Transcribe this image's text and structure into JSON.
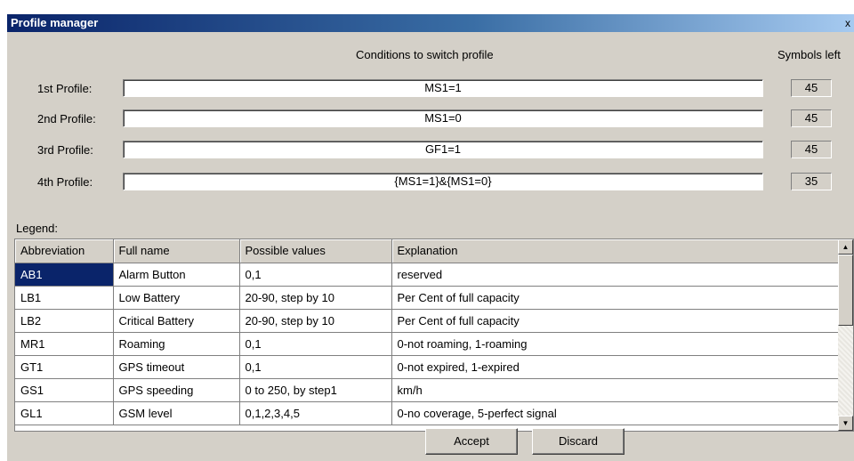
{
  "window": {
    "title": "Profile manager",
    "close_glyph": "x"
  },
  "headers": {
    "conditions": "Conditions to switch profile",
    "symbols_left": "Symbols left"
  },
  "profiles": [
    {
      "label": "1st Profile:",
      "condition": "MS1=1",
      "symbols_left": "45"
    },
    {
      "label": "2nd Profile:",
      "condition": "MS1=0",
      "symbols_left": "45"
    },
    {
      "label": "3rd Profile:",
      "condition": "GF1=1",
      "symbols_left": "45"
    },
    {
      "label": "4th Profile:",
      "condition": "{MS1=1}&{MS1=0}",
      "symbols_left": "35"
    }
  ],
  "legend": {
    "label": "Legend:",
    "columns": [
      "Abbreviation",
      "Full name",
      "Possible values",
      "Explanation"
    ],
    "rows": [
      [
        "AB1",
        "Alarm Button",
        "0,1",
        "reserved"
      ],
      [
        "LB1",
        "Low Battery",
        "20-90, step by 10",
        "Per Cent of full capacity"
      ],
      [
        "LB2",
        "Critical Battery",
        "20-90, step by 10",
        "Per Cent of full capacity"
      ],
      [
        "MR1",
        "Roaming",
        "0,1",
        "0-not roaming, 1-roaming"
      ],
      [
        "GT1",
        "GPS timeout",
        "0,1",
        "0-not expired, 1-expired"
      ],
      [
        "GS1",
        "GPS speeding",
        "0 to 250, by step1",
        "km/h"
      ],
      [
        "GL1",
        "GSM level",
        "0,1,2,3,4,5",
        "0-no coverage, 5-perfect signal"
      ]
    ],
    "selected_row": 0
  },
  "buttons": {
    "accept": "Accept",
    "discard": "Discard"
  },
  "icons": {
    "scroll_up": "scroll-up-arrow-icon",
    "scroll_down": "scroll-down-arrow-icon"
  }
}
